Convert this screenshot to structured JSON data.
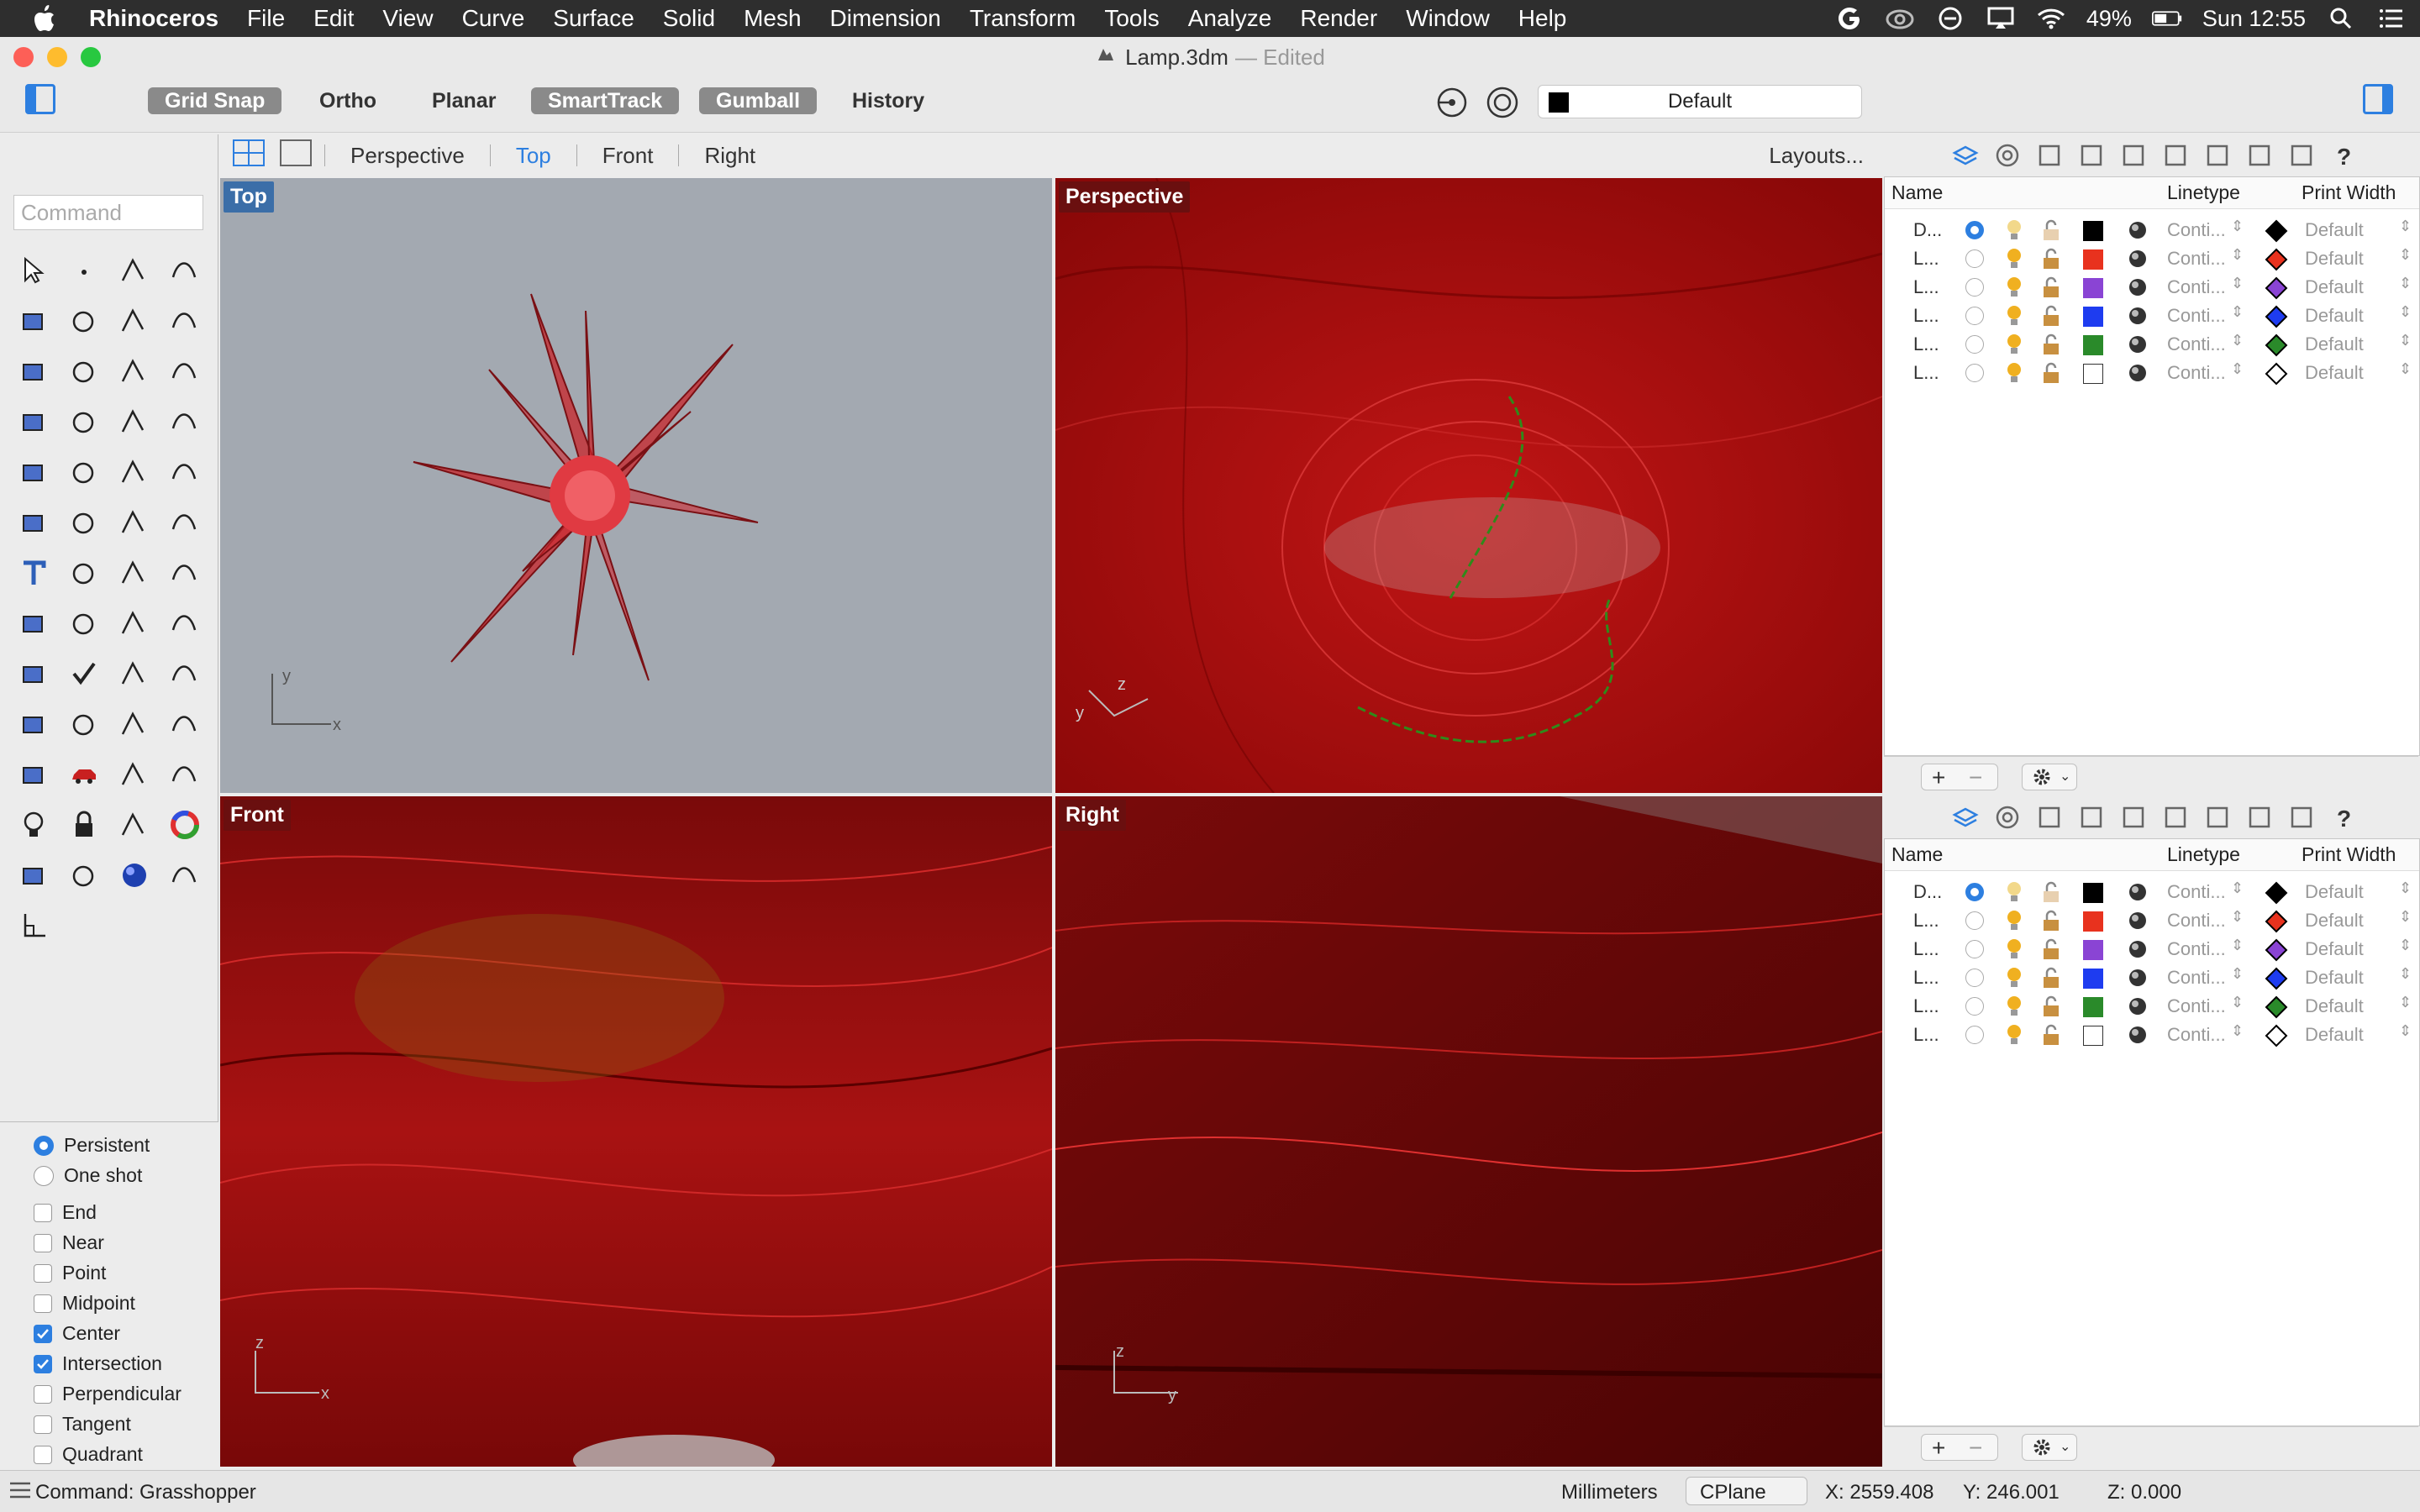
{
  "menubar": {
    "app": "Rhinoceros",
    "items": [
      "File",
      "Edit",
      "View",
      "Curve",
      "Surface",
      "Solid",
      "Mesh",
      "Dimension",
      "Transform",
      "Tools",
      "Analyze",
      "Render",
      "Window",
      "Help"
    ],
    "battery": "49%",
    "clock": "Sun 12:55"
  },
  "window": {
    "filename": "Lamp.3dm",
    "state": "— Edited"
  },
  "toolbar": {
    "toggles": [
      {
        "label": "Grid Snap",
        "on": true
      },
      {
        "label": "Ortho",
        "on": false
      },
      {
        "label": "Planar",
        "on": false
      },
      {
        "label": "SmartTrack",
        "on": true
      },
      {
        "label": "Gumball",
        "on": true
      },
      {
        "label": "History",
        "on": false
      }
    ],
    "layer": "Default"
  },
  "viewport_tabs": [
    "Perspective",
    "Top",
    "Front",
    "Right"
  ],
  "active_tab": "Top",
  "layouts_label": "Layouts...",
  "command_placeholder": "Command",
  "viewports": {
    "top": "Top",
    "perspective": "Perspective",
    "front": "Front",
    "right": "Right"
  },
  "axis_labels": {
    "x": "x",
    "y": "y",
    "z": "z"
  },
  "osnap": {
    "mode": [
      {
        "label": "Persistent",
        "on": true
      },
      {
        "label": "One shot",
        "on": false
      }
    ],
    "snaps": [
      {
        "label": "End",
        "on": false
      },
      {
        "label": "Near",
        "on": false
      },
      {
        "label": "Point",
        "on": false
      },
      {
        "label": "Midpoint",
        "on": false
      },
      {
        "label": "Center",
        "on": true
      },
      {
        "label": "Intersection",
        "on": true
      },
      {
        "label": "Perpendicular",
        "on": false
      },
      {
        "label": "Tangent",
        "on": false
      },
      {
        "label": "Quadrant",
        "on": false
      }
    ]
  },
  "layers_panel": {
    "headers": {
      "name": "Name",
      "linetype": "Linetype",
      "print_width": "Print Width"
    },
    "rows": [
      {
        "name": "D...",
        "current": true,
        "color": "#000000",
        "linetype": "Conti...",
        "print_width": "Default"
      },
      {
        "name": "L...",
        "current": false,
        "color": "#e8321e",
        "linetype": "Conti...",
        "print_width": "Default"
      },
      {
        "name": "L...",
        "current": false,
        "color": "#8a44d4",
        "linetype": "Conti...",
        "print_width": "Default"
      },
      {
        "name": "L...",
        "current": false,
        "color": "#1e3cf0",
        "linetype": "Conti...",
        "print_width": "Default"
      },
      {
        "name": "L...",
        "current": false,
        "color": "#2a8a2a",
        "linetype": "Conti...",
        "print_width": "Default"
      },
      {
        "name": "L...",
        "current": false,
        "color": "#ffffff",
        "linetype": "Conti...",
        "print_width": "Default"
      }
    ]
  },
  "status": {
    "command": "Command: Grasshopper",
    "units": "Millimeters",
    "cplane": "CPlane",
    "x": "X: 2559.408",
    "y": "Y: 246.001",
    "z": "Z: 0.000"
  },
  "colors": {
    "accent": "#2d7fe0",
    "viewport_red": "#9e0a0a",
    "top_bg": "#a2a8b0"
  }
}
